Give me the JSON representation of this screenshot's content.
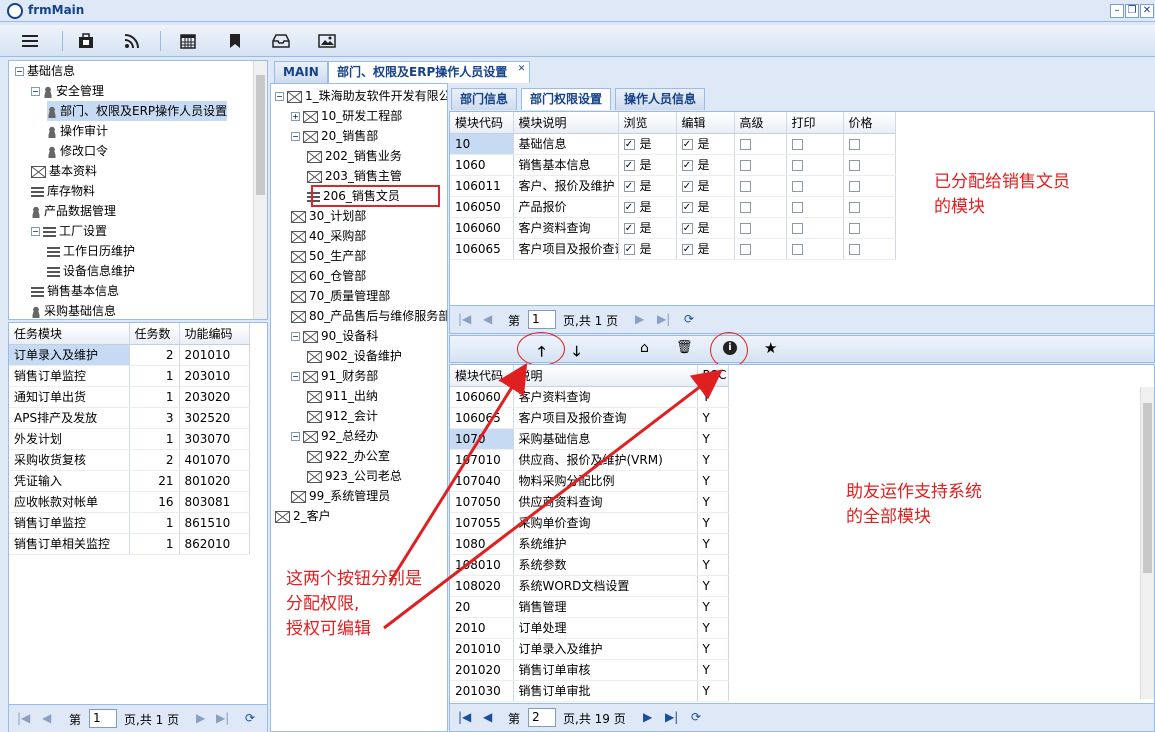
{
  "window": {
    "title": "frmMain"
  },
  "toolbar": {
    "icons": [
      "menu-icon",
      "briefcase-icon",
      "rss-icon",
      "calendar-icon",
      "bookmark-icon",
      "inbox-icon",
      "image-icon"
    ]
  },
  "nav_tree": {
    "items": [
      {
        "label": "基础信息",
        "level": 0,
        "expander": "−"
      },
      {
        "label": "安全管理",
        "level": 1,
        "expander": "−"
      },
      {
        "label": "部门、权限及ERP操作人员设置",
        "level": 2
      },
      {
        "label": "操作审计",
        "level": 2
      },
      {
        "label": "修改口令",
        "level": 2
      },
      {
        "label": "基本资料",
        "level": 1
      },
      {
        "label": "库存物料",
        "level": 1
      },
      {
        "label": "产品数据管理",
        "level": 1
      },
      {
        "label": "工厂设置",
        "level": 1,
        "expander": "−"
      },
      {
        "label": "工作日历维护",
        "level": 2
      },
      {
        "label": "设备信息维护",
        "level": 2
      },
      {
        "label": "销售基本信息",
        "level": 1
      },
      {
        "label": "采购基础信息",
        "level": 1
      }
    ]
  },
  "task_table": {
    "headers": [
      "任务模块",
      "任务数",
      "功能编码"
    ],
    "rows": [
      [
        "订单录入及维护",
        "2",
        "201010"
      ],
      [
        "销售订单监控",
        "1",
        "203010"
      ],
      [
        "通知订单出货",
        "1",
        "203020"
      ],
      [
        "APS排产及发放",
        "3",
        "302520"
      ],
      [
        "外发计划",
        "1",
        "303070"
      ],
      [
        "采购收货复核",
        "2",
        "401070"
      ],
      [
        "凭证输入",
        "21",
        "801020"
      ],
      [
        "应收帐款对帐单",
        "16",
        "803081"
      ],
      [
        "销售订单监控",
        "1",
        "861510"
      ],
      [
        "销售订单相关监控",
        "1",
        "862010"
      ]
    ],
    "pager": {
      "prefix": "第",
      "page": "1",
      "suffix": "页,共 1 页"
    }
  },
  "main_tabs": [
    {
      "label": "MAIN"
    },
    {
      "label": "部门、权限及ERP操作人员设置"
    }
  ],
  "org_tree": {
    "items": [
      {
        "label": "1_珠海助友软件开发有限公司",
        "level": 0
      },
      {
        "label": "10_研发工程部",
        "level": 1
      },
      {
        "label": "20_销售部",
        "level": 1
      },
      {
        "label": "202_销售业务",
        "level": 2
      },
      {
        "label": "203_销售主管",
        "level": 2
      },
      {
        "label": "206_销售文员",
        "level": 2
      },
      {
        "label": "30_计划部",
        "level": 1
      },
      {
        "label": "40_采购部",
        "level": 1
      },
      {
        "label": "50_生产部",
        "level": 1
      },
      {
        "label": "60_仓管部",
        "level": 1
      },
      {
        "label": "70_质量管理部",
        "level": 1
      },
      {
        "label": "80_产品售后与维修服务部",
        "level": 1
      },
      {
        "label": "90_设备科",
        "level": 1
      },
      {
        "label": "902_设备维护",
        "level": 2
      },
      {
        "label": "91_财务部",
        "level": 1
      },
      {
        "label": "911_出纳",
        "level": 2
      },
      {
        "label": "912_会计",
        "level": 2
      },
      {
        "label": "92_总经办",
        "level": 1
      },
      {
        "label": "922_办公室",
        "level": 2
      },
      {
        "label": "923_公司老总",
        "level": 2
      },
      {
        "label": "99_系统管理员",
        "level": 1
      },
      {
        "label": "2_客户",
        "level": 0
      }
    ]
  },
  "sub_tabs": [
    {
      "label": "部门信息"
    },
    {
      "label": "部门权限设置"
    },
    {
      "label": "操作人员信息"
    }
  ],
  "perm_table": {
    "headers": [
      "模块代码",
      "模块说明",
      "浏览",
      "编辑",
      "高级",
      "打印",
      "价格"
    ],
    "yes": "是",
    "rows": [
      {
        "code": "10",
        "desc": "基础信息",
        "view": true,
        "edit": true
      },
      {
        "code": "1060",
        "desc": "销售基本信息",
        "view": true,
        "edit": true
      },
      {
        "code": "106011",
        "desc": "客户、报价及维护",
        "view": true,
        "edit": true
      },
      {
        "code": "106050",
        "desc": "产品报价",
        "view": true,
        "edit": true
      },
      {
        "code": "106060",
        "desc": "客户资料查询",
        "view": true,
        "edit": true
      },
      {
        "code": "106065",
        "desc": "客户项目及报价查询",
        "view": true,
        "edit": true
      }
    ],
    "pager": {
      "prefix": "第",
      "page": "1",
      "suffix": "页,共 1 页"
    }
  },
  "module_table": {
    "headers": [
      "模块代码",
      "说明",
      "PCC"
    ],
    "rows": [
      [
        "106060",
        "客户资料查询",
        "Y"
      ],
      [
        "106065",
        "客户项目及报价查询",
        "Y"
      ],
      [
        "1070",
        "采购基础信息",
        "Y"
      ],
      [
        "107010",
        "供应商、报价及维护(VRM)",
        "Y"
      ],
      [
        "107040",
        "物料采购分配比例",
        "Y"
      ],
      [
        "107050",
        "供应商资料查询",
        "Y"
      ],
      [
        "107055",
        "采购单价查询",
        "Y"
      ],
      [
        "1080",
        "系统维护",
        "Y"
      ],
      [
        "108010",
        "系统参数",
        "Y"
      ],
      [
        "108020",
        "系统WORD文档设置",
        "Y"
      ],
      [
        "20",
        "销售管理",
        "Y"
      ],
      [
        "2010",
        "订单处理",
        "Y"
      ],
      [
        "201010",
        "订单录入及维护",
        "Y"
      ],
      [
        "201020",
        "销售订单审核",
        "Y"
      ],
      [
        "201030",
        "销售订单审批",
        "Y"
      ]
    ],
    "pager": {
      "prefix": "第",
      "page": "2",
      "suffix": "页,共 19 页"
    }
  },
  "annotations": {
    "assigned_line1": "已分配给销售文员",
    "assigned_line2": "的模块",
    "all_line1": "助友运作支持系统",
    "all_line2": "的全部模块",
    "buttons_line1": "这两个按钮分别是",
    "buttons_line2": "分配权限,",
    "buttons_line3": "授权可编辑"
  },
  "colors": {
    "accent": "#15428b",
    "annotation": "#e02020",
    "selected": "#c6dbf3"
  }
}
